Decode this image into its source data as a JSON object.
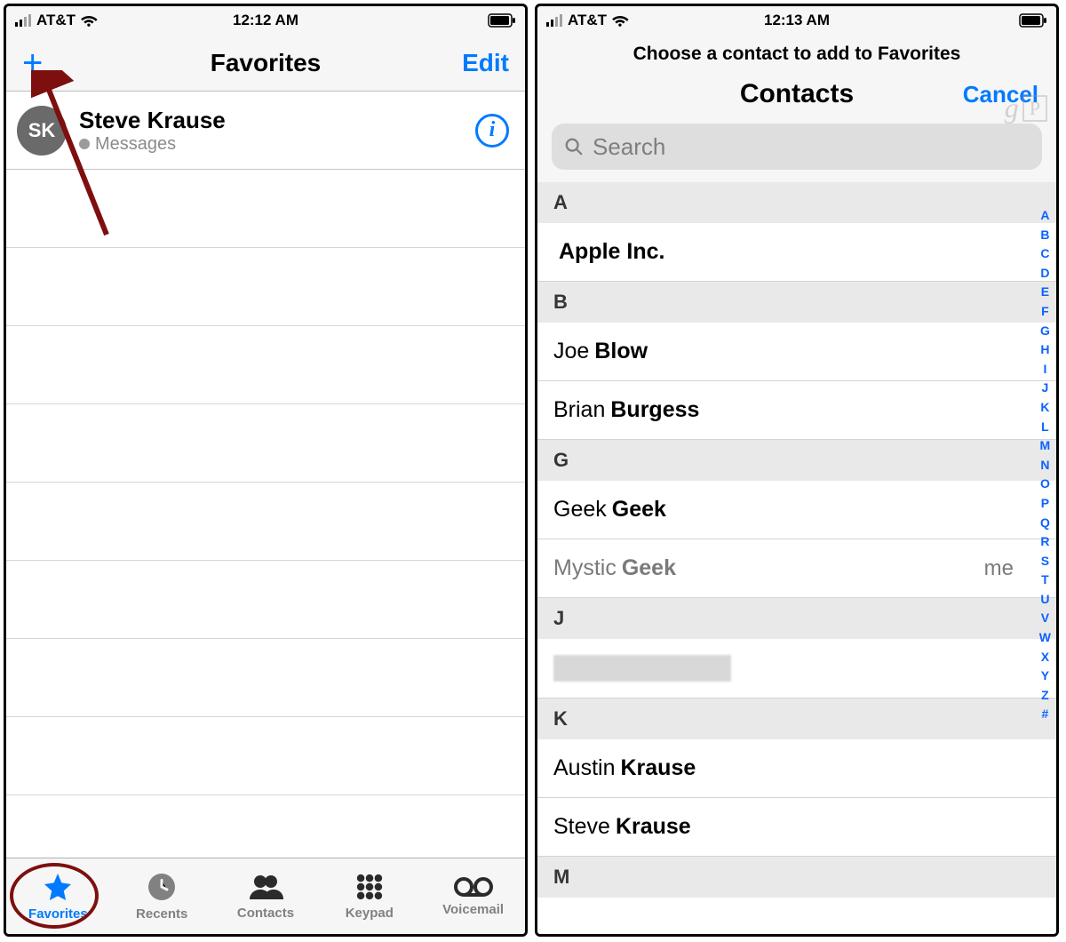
{
  "status": {
    "carrier": "AT&T",
    "battery_level": 90
  },
  "screen1": {
    "time": "12:12 AM",
    "nav": {
      "title": "Favorites",
      "edit": "Edit"
    },
    "favorite": {
      "initials": "SK",
      "name": "Steve Krause",
      "subtitle": "Messages"
    },
    "tabs": {
      "favorites": "Favorites",
      "recents": "Recents",
      "contacts": "Contacts",
      "keypad": "Keypad",
      "voicemail": "Voicemail"
    }
  },
  "screen2": {
    "time": "12:13 AM",
    "instruction": "Choose a contact to add to Favorites",
    "title": "Contacts",
    "cancel": "Cancel",
    "search_placeholder": "Search",
    "watermark": "gP",
    "sections": {
      "A": [
        {
          "first": "",
          "last": "Apple Inc."
        }
      ],
      "B": [
        {
          "first": "Joe",
          "last": "Blow"
        },
        {
          "first": "Brian",
          "last": "Burgess"
        }
      ],
      "G": [
        {
          "first": "Geek",
          "last": "Geek"
        },
        {
          "first": "Mystic",
          "last": "Geek",
          "me": "me",
          "gray": true
        }
      ],
      "J": [
        {
          "redacted": true
        }
      ],
      "K": [
        {
          "first": "Austin",
          "last": "Krause"
        },
        {
          "first": "Steve",
          "last": "Krause"
        }
      ],
      "M": []
    },
    "index": [
      "A",
      "B",
      "C",
      "D",
      "E",
      "F",
      "G",
      "H",
      "I",
      "J",
      "K",
      "L",
      "M",
      "N",
      "O",
      "P",
      "Q",
      "R",
      "S",
      "T",
      "U",
      "V",
      "W",
      "X",
      "Y",
      "Z",
      "#"
    ]
  },
  "icons": {
    "plus": "plus-icon",
    "wifi": "wifi-icon",
    "battery": "battery-icon",
    "info": "info-icon",
    "star": "star-icon",
    "clock": "clock-icon",
    "people": "people-icon",
    "keypad": "keypad-icon",
    "voicemail": "voicemail-icon",
    "search": "search-icon"
  }
}
